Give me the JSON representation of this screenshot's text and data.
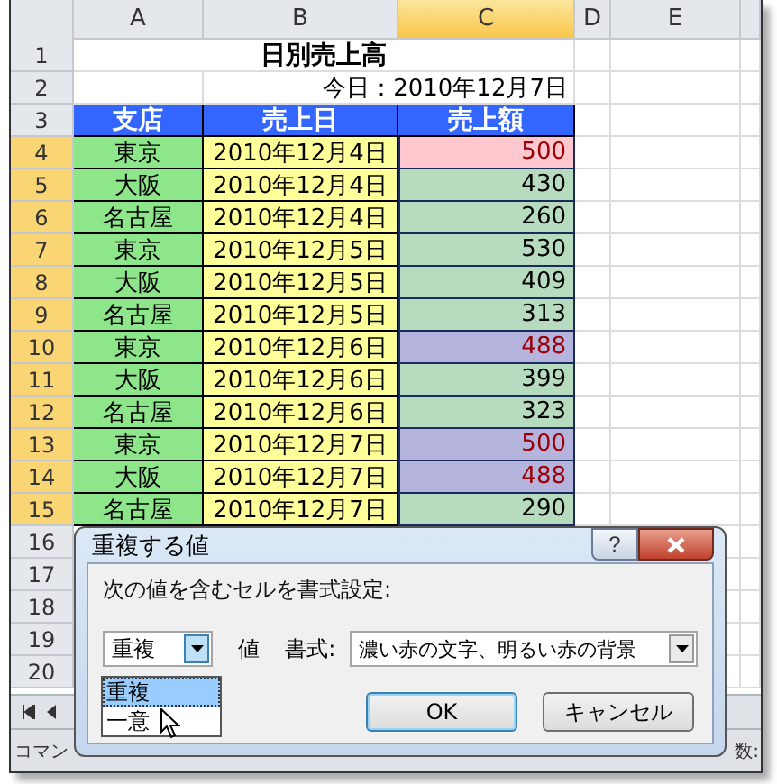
{
  "sheet": {
    "columns": [
      {
        "label": "A",
        "selected": false
      },
      {
        "label": "B",
        "selected": false
      },
      {
        "label": "C",
        "selected": true
      },
      {
        "label": "D",
        "selected": false
      },
      {
        "label": "E",
        "selected": false
      }
    ],
    "row_headers": [
      {
        "label": "1",
        "selected": false
      },
      {
        "label": "2",
        "selected": false
      },
      {
        "label": "3",
        "selected": false
      },
      {
        "label": "4",
        "selected": true
      },
      {
        "label": "5",
        "selected": true
      },
      {
        "label": "6",
        "selected": true
      },
      {
        "label": "7",
        "selected": true
      },
      {
        "label": "8",
        "selected": true
      },
      {
        "label": "9",
        "selected": true
      },
      {
        "label": "10",
        "selected": true
      },
      {
        "label": "11",
        "selected": true
      },
      {
        "label": "12",
        "selected": true
      },
      {
        "label": "13",
        "selected": true
      },
      {
        "label": "14",
        "selected": true
      },
      {
        "label": "15",
        "selected": true
      },
      {
        "label": "16",
        "selected": false
      },
      {
        "label": "17",
        "selected": false
      },
      {
        "label": "18",
        "selected": false
      },
      {
        "label": "19",
        "selected": false
      },
      {
        "label": "20",
        "selected": false
      }
    ],
    "title": "日別売上高",
    "today": "今日：2010年12月7日",
    "header": [
      "支店",
      "売上日",
      "売上額"
    ],
    "records": [
      {
        "branch": "東京",
        "date": "2010年12月4日",
        "amount": "500",
        "duplicate": true,
        "color": "#ffc7ce"
      },
      {
        "branch": "大阪",
        "date": "2010年12月4日",
        "amount": "430",
        "duplicate": false,
        "color": "#b7dbbf"
      },
      {
        "branch": "名古屋",
        "date": "2010年12月4日",
        "amount": "260",
        "duplicate": false,
        "color": "#b7dbbf"
      },
      {
        "branch": "東京",
        "date": "2010年12月5日",
        "amount": "530",
        "duplicate": false,
        "color": "#b7dbbf"
      },
      {
        "branch": "大阪",
        "date": "2010年12月5日",
        "amount": "409",
        "duplicate": false,
        "color": "#b7dbbf"
      },
      {
        "branch": "名古屋",
        "date": "2010年12月5日",
        "amount": "313",
        "duplicate": false,
        "color": "#b7dbbf"
      },
      {
        "branch": "東京",
        "date": "2010年12月6日",
        "amount": "488",
        "duplicate": true,
        "color": "#b4b4dc"
      },
      {
        "branch": "大阪",
        "date": "2010年12月6日",
        "amount": "399",
        "duplicate": false,
        "color": "#b7dbbf"
      },
      {
        "branch": "名古屋",
        "date": "2010年12月6日",
        "amount": "323",
        "duplicate": false,
        "color": "#b7dbbf"
      },
      {
        "branch": "東京",
        "date": "2010年12月7日",
        "amount": "500",
        "duplicate": true,
        "color": "#b4b4dc"
      },
      {
        "branch": "大阪",
        "date": "2010年12月7日",
        "amount": "488",
        "duplicate": true,
        "color": "#b4b4dc"
      },
      {
        "branch": "名古屋",
        "date": "2010年12月7日",
        "amount": "290",
        "duplicate": false,
        "color": "#b7dbbf"
      }
    ]
  },
  "status_bar": {
    "left": "コマン",
    "right": "数:"
  },
  "dialog": {
    "title": "重複する値",
    "help": "?",
    "prompt": "次の値を含むセルを書式設定:",
    "rule_dropdown": {
      "value": "重複",
      "expanded": true,
      "options": [
        {
          "label": "重複",
          "selected": true
        },
        {
          "label": "一意",
          "selected": false
        }
      ]
    },
    "value_label": "値",
    "format_label": "書式:",
    "format_dropdown": {
      "value": "濃い赤の文字、明るい赤の背景"
    },
    "buttons": [
      {
        "label": "OK",
        "default": true
      },
      {
        "label": "キャンセル",
        "default": false
      }
    ]
  }
}
